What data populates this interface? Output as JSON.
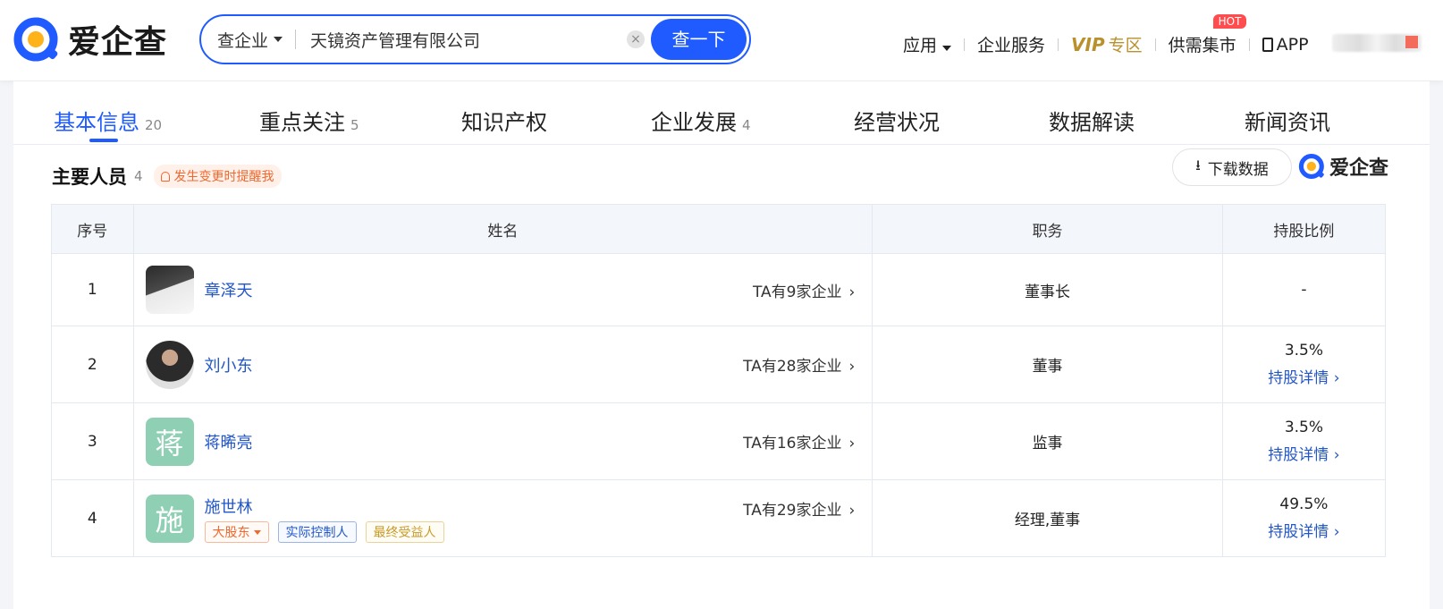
{
  "header": {
    "brand": "爱企查",
    "search": {
      "type": "查企业",
      "value": "天镜资产管理有限公司",
      "button": "查一下",
      "clear": "×"
    },
    "nav": [
      {
        "label": "应用"
      },
      {
        "label": "企业服务"
      },
      {
        "vip_logo": "VIP",
        "label": "专区"
      },
      {
        "label": "供需集市",
        "badge": "HOT"
      },
      {
        "label": "APP"
      }
    ]
  },
  "tabs": [
    {
      "label": "基本信息",
      "count": "20"
    },
    {
      "label": "重点关注",
      "count": "5"
    },
    {
      "label": "知识产权",
      "count": ""
    },
    {
      "label": "企业发展",
      "count": "4"
    },
    {
      "label": "经营状况",
      "count": ""
    },
    {
      "label": "数据解读",
      "count": ""
    },
    {
      "label": "新闻资讯",
      "count": ""
    }
  ],
  "section": {
    "title": "主要人员",
    "count": "4",
    "remind": "发生变更时提醒我",
    "download": "下载数据",
    "brand": "爱企查"
  },
  "table": {
    "headers": [
      "序号",
      "姓名",
      "职务",
      "持股比例"
    ],
    "rows": [
      {
        "idx": "1",
        "name": "章泽天",
        "avatar": "",
        "ta": "TA有9家企业",
        "position": "董事长",
        "share": "-",
        "share_link": "",
        "tags": []
      },
      {
        "idx": "2",
        "name": "刘小东",
        "avatar": "",
        "ta": "TA有28家企业",
        "position": "董事",
        "share": "3.5%",
        "share_link": "持股详情",
        "tags": []
      },
      {
        "idx": "3",
        "name": "蒋晞亮",
        "avatar": "蒋",
        "ta": "TA有16家企业",
        "position": "监事",
        "share": "3.5%",
        "share_link": "持股详情",
        "tags": []
      },
      {
        "idx": "4",
        "name": "施世林",
        "avatar": "施",
        "ta": "TA有29家企业",
        "position": "经理,董事",
        "share": "49.5%",
        "share_link": "持股详情",
        "tags": [
          "大股东",
          "实际控制人",
          "最终受益人"
        ]
      }
    ]
  },
  "colors": {
    "accent": "#1f5bff",
    "link": "#2256c7",
    "warn": "#f0682e",
    "vip": "#b9902b"
  }
}
